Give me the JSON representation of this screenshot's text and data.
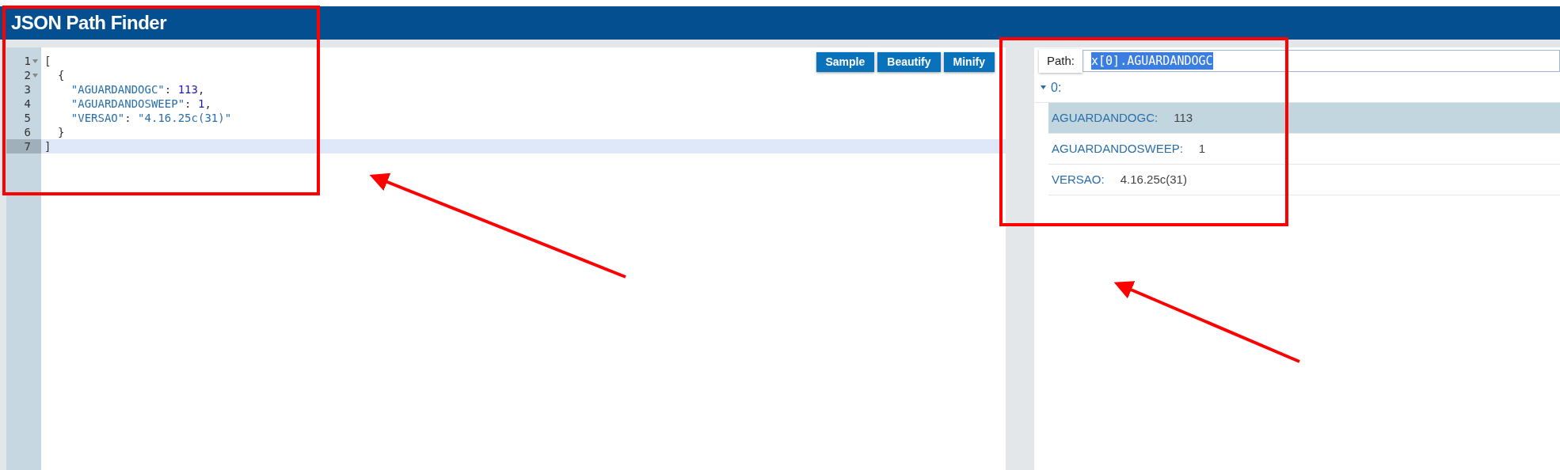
{
  "header": {
    "title": "JSON Path Finder"
  },
  "editor": {
    "buttons": [
      "Sample",
      "Beautify",
      "Minify"
    ],
    "lines": [
      {
        "number": "1",
        "fold": true,
        "current": false,
        "tokens": [
          {
            "kind": "punct",
            "text": "["
          }
        ]
      },
      {
        "number": "2",
        "fold": true,
        "current": false,
        "tokens": [
          {
            "kind": "punct",
            "text": "{"
          }
        ]
      },
      {
        "number": "3",
        "fold": false,
        "current": false,
        "tokens": [
          {
            "kind": "key",
            "text": "\"AGUARDANDOGC\""
          },
          {
            "kind": "punct",
            "text": ": "
          },
          {
            "kind": "number",
            "text": "113"
          },
          {
            "kind": "punct",
            "text": ","
          }
        ]
      },
      {
        "number": "4",
        "fold": false,
        "current": false,
        "tokens": [
          {
            "kind": "key",
            "text": "\"AGUARDANDOSWEEP\""
          },
          {
            "kind": "punct",
            "text": ": "
          },
          {
            "kind": "number",
            "text": "1"
          },
          {
            "kind": "punct",
            "text": ","
          }
        ]
      },
      {
        "number": "5",
        "fold": false,
        "current": false,
        "tokens": [
          {
            "kind": "key",
            "text": "\"VERSAO\""
          },
          {
            "kind": "punct",
            "text": ": "
          },
          {
            "kind": "string",
            "text": "\"4.16.25c(31)\""
          }
        ]
      },
      {
        "number": "6",
        "fold": false,
        "current": false,
        "tokens": [
          {
            "kind": "punct",
            "text": "}"
          }
        ]
      },
      {
        "number": "7",
        "fold": false,
        "current": true,
        "tokens": [
          {
            "kind": "punct",
            "text": "]"
          }
        ]
      }
    ]
  },
  "viewer": {
    "path": {
      "label": "Path:",
      "value": "x[0].AGUARDANDOGC",
      "text_selected": true
    },
    "tree": {
      "label": "0:",
      "expanded": true,
      "children": [
        {
          "key": "AGUARDANDOGC:",
          "value": "113",
          "selected": true
        },
        {
          "key": "AGUARDANDOSWEEP:",
          "value": "1",
          "selected": false
        },
        {
          "key": "VERSAO:",
          "value": "4.16.25c(31)",
          "selected": false
        }
      ]
    }
  }
}
